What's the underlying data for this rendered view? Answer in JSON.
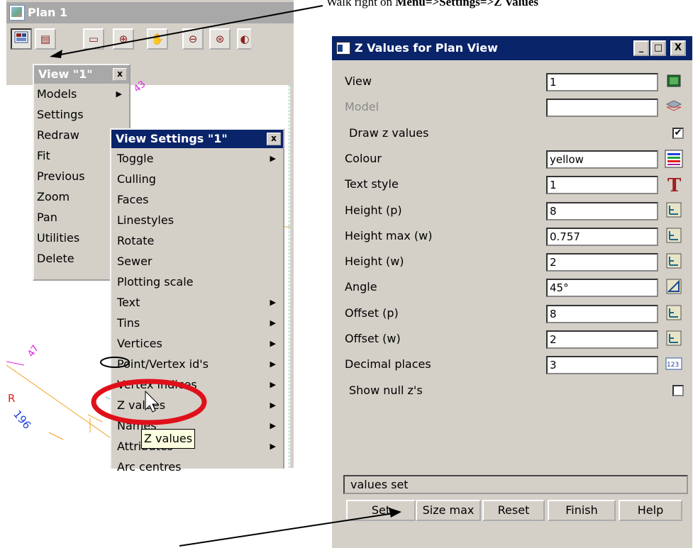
{
  "caption": {
    "prefix": "Walk right on ",
    "bold": "Menu=>Settings=>Z Values"
  },
  "plan_window": {
    "title": "Plan 1",
    "toolbar_icons": [
      "view-menu-icon",
      "tool-icon",
      "tool-icon",
      "zoom-crosshair-icon",
      "pan-hand-icon",
      "zoom-in-out-icon",
      "zoom-center-icon",
      "tool-icon"
    ],
    "canvas_labels": [
      "43",
      "47",
      "R",
      "196"
    ]
  },
  "view_menu": {
    "title": "View \"1\"",
    "close": "x",
    "items": [
      "Models",
      "Settings",
      "Redraw",
      "Fit",
      "Previous",
      "Zoom",
      "Pan",
      "Utilities",
      "Delete"
    ],
    "submenu_marks": [
      true,
      false,
      false,
      false,
      false,
      false,
      false,
      false,
      false
    ]
  },
  "view_settings_menu": {
    "title": "View Settings \"1\"",
    "close": "x",
    "items": [
      {
        "label": "Toggle",
        "sub": true
      },
      {
        "label": "Culling",
        "sub": false
      },
      {
        "label": "Faces",
        "sub": false
      },
      {
        "label": "Linestyles",
        "sub": false
      },
      {
        "label": "Rotate",
        "sub": false
      },
      {
        "label": "Sewer",
        "sub": false
      },
      {
        "label": "Plotting scale",
        "sub": false
      },
      {
        "label": "Text",
        "sub": true
      },
      {
        "label": "Tins",
        "sub": true
      },
      {
        "label": "Vertices",
        "sub": true
      },
      {
        "label": "Point/Vertex id's",
        "sub": true
      },
      {
        "label": "Vertex indices",
        "sub": true
      },
      {
        "label": "Z values",
        "sub": true
      },
      {
        "label": "Names",
        "sub": true
      },
      {
        "label": "Attributes",
        "sub": true
      },
      {
        "label": "Arc centres",
        "sub": false
      }
    ]
  },
  "tooltip": "Z values",
  "dialog": {
    "title": "Z Values for Plan View",
    "window_buttons": [
      "_",
      "□",
      "X"
    ],
    "rows": [
      {
        "label": "View",
        "value": "1",
        "icon": "view-select-icon",
        "disabled": false
      },
      {
        "label": "Model",
        "value": "",
        "icon": "model-layers-icon",
        "disabled": true
      },
      {
        "label": "Draw z values",
        "checkbox": true,
        "checked": true
      },
      {
        "label": "Colour",
        "value": "yellow",
        "icon": "colour-picker-icon",
        "disabled": false
      },
      {
        "label": "Text style",
        "value": "1",
        "icon": "text-style-icon",
        "disabled": false
      },
      {
        "label": "Height (p)",
        "value": "8",
        "icon": "measure-icon",
        "disabled": false
      },
      {
        "label": "Height max (w)",
        "value": "0.757",
        "icon": "measure-icon",
        "disabled": false
      },
      {
        "label": "Height (w)",
        "value": "2",
        "icon": "measure-icon",
        "disabled": false
      },
      {
        "label": "Angle",
        "value": "45°",
        "icon": "angle-icon",
        "disabled": false
      },
      {
        "label": "Offset (p)",
        "value": "8",
        "icon": "measure-icon",
        "disabled": false
      },
      {
        "label": "Offset (w)",
        "value": "2",
        "icon": "measure-icon",
        "disabled": false
      },
      {
        "label": "Decimal places",
        "value": "3",
        "icon": "number-123-icon",
        "disabled": false
      },
      {
        "label": "Show null z's",
        "checkbox": true,
        "checked": false
      }
    ],
    "status": "values set",
    "buttons": [
      "Set",
      "Size max",
      "Reset",
      "Finish",
      "Help"
    ],
    "check_mark": "✔",
    "icon_glyphs": {
      "colour": "#1a8",
      "text_style": "T",
      "number": "123"
    }
  },
  "colors": {
    "title_active": "#0a246a",
    "title_inactive": "#a8a8a8",
    "highlight_ellipse": "#e0101a",
    "window_bg": "#d4d0c8"
  }
}
